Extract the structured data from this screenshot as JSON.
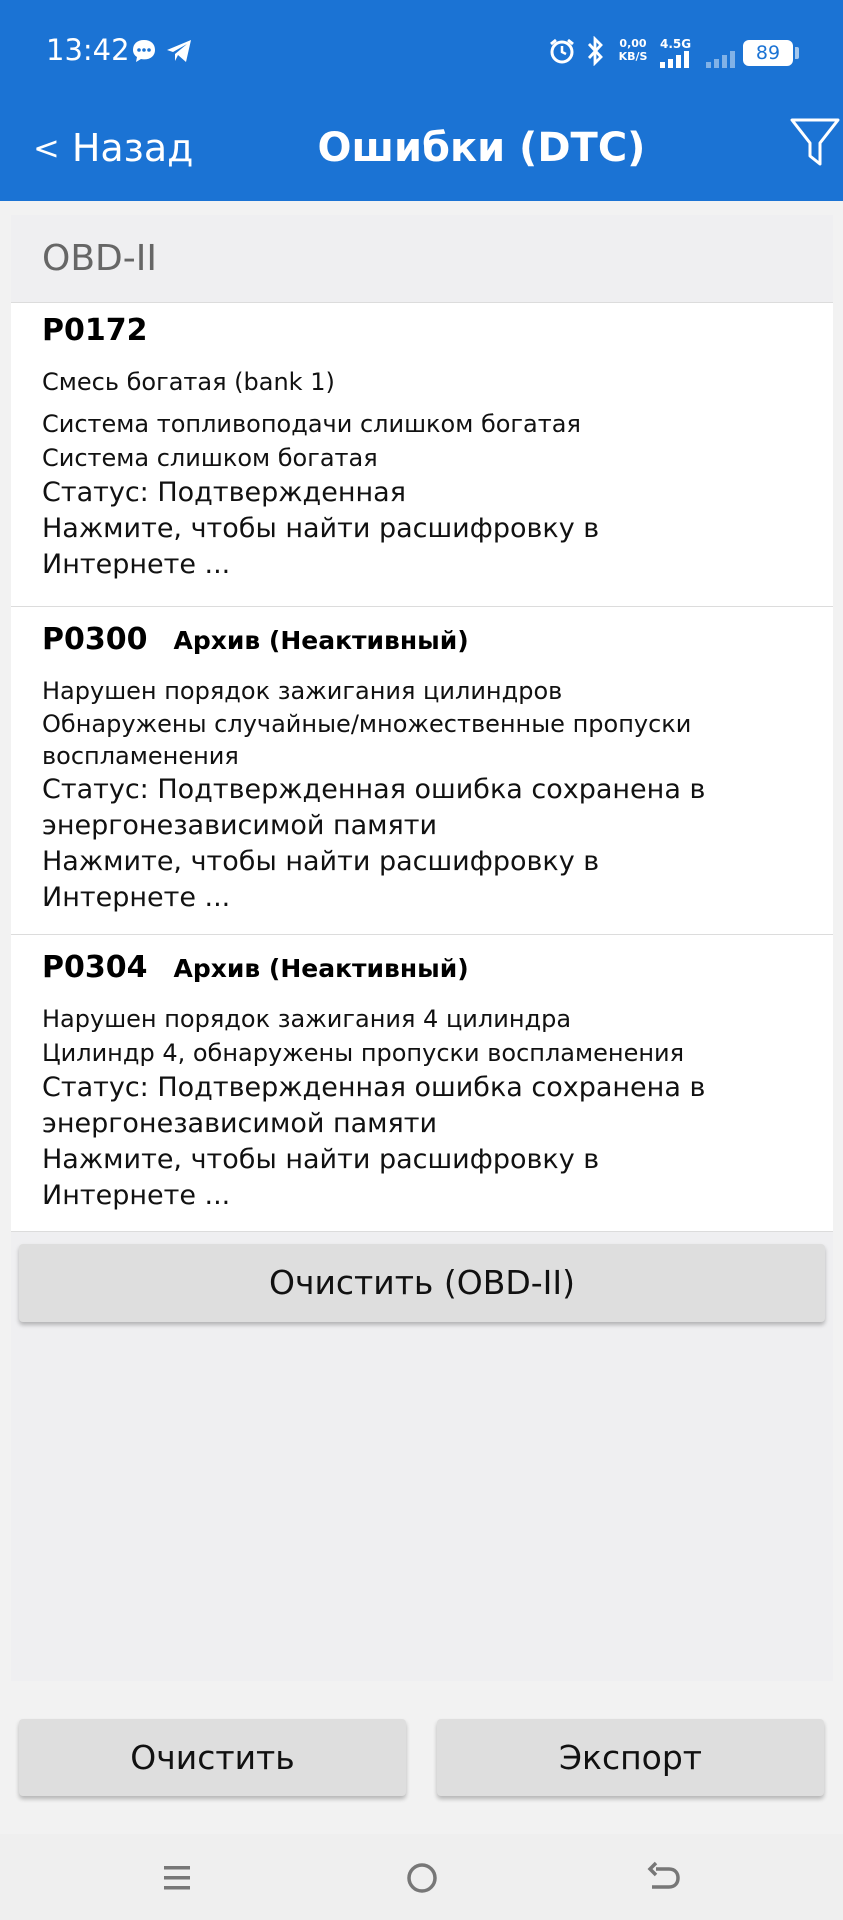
{
  "status_bar": {
    "time": "13:42",
    "net_speed": "0,00",
    "net_unit": "KB/S",
    "network_type": "4.5G",
    "battery": "89"
  },
  "appbar": {
    "back_label": "Назад",
    "back_chevron": "<",
    "title": "Ошибки (DTC)",
    "filter_icon": "filter-funnel-icon"
  },
  "section": {
    "header": "OBD-II"
  },
  "dtcs": [
    {
      "code": "P0172",
      "tag": "",
      "short": "Смесь богатая (bank 1)",
      "desc1": "Система топливоподачи слишком богатая",
      "desc2": "Система слишком богатая",
      "status": "Статус: Подтвержденная",
      "lookup": "Нажмите, чтобы найти расшифровку в Интернете ..."
    },
    {
      "code": "P0300",
      "tag": "Архив (Неактивный)",
      "short": "Нарушен порядок зажигания цилиндров",
      "desc1": "Обнаружены случайные/множественные пропуски воспламенения",
      "status": "Статус: Подтвержденная ошибка сохранена в энергонезависимой памяти",
      "lookup": "Нажмите, чтобы найти расшифровку в Интернете ..."
    },
    {
      "code": "P0304",
      "tag": "Архив (Неактивный)",
      "short": "Нарушен порядок зажигания 4 цилиндра",
      "desc1": "Цилиндр 4, обнаружены пропуски воспламенения",
      "status": "Статус: Подтвержденная ошибка сохранена в энергонезависимой памяти",
      "lookup": "Нажмите, чтобы найти расшифровку в Интернете ..."
    }
  ],
  "buttons": {
    "clear_obd": "Очистить (OBD-II)",
    "clear": "Очистить",
    "export": "Экспорт"
  },
  "navbar": {
    "menu_icon": "menu-icon",
    "home_icon": "home-circle-icon",
    "back_icon": "back-arrow-icon"
  },
  "colors": {
    "header_bg": "#1b73d4",
    "button_bg": "#dedede",
    "panel_bg": "#efeff1"
  }
}
